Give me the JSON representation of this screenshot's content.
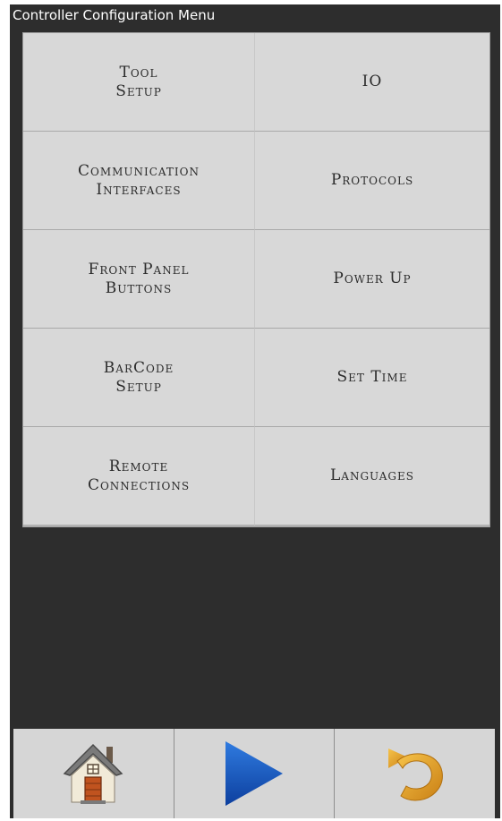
{
  "window": {
    "title": "Controller Configuration Menu"
  },
  "menu": {
    "items": [
      {
        "lines": [
          "Tool",
          "Setup"
        ]
      },
      {
        "lines": [
          "IO"
        ]
      },
      {
        "lines": [
          "Communication",
          "Interfaces"
        ]
      },
      {
        "lines": [
          "Protocols"
        ]
      },
      {
        "lines": [
          "Front Panel",
          "Buttons"
        ]
      },
      {
        "lines": [
          "Power Up"
        ]
      },
      {
        "lines": [
          "BarCode",
          "Setup"
        ]
      },
      {
        "lines": [
          "Set Time"
        ]
      },
      {
        "lines": [
          "Remote",
          "Connections"
        ]
      },
      {
        "lines": [
          "Languages"
        ]
      }
    ]
  },
  "toolbar": {
    "buttons": [
      {
        "icon": "home-icon"
      },
      {
        "icon": "play-icon"
      },
      {
        "icon": "undo-icon"
      }
    ]
  },
  "colors": {
    "background": "#2d2d2d",
    "tile": "#d8d8d8",
    "play_blue": "#1e63c8",
    "undo_orange": "#e8a22e"
  }
}
